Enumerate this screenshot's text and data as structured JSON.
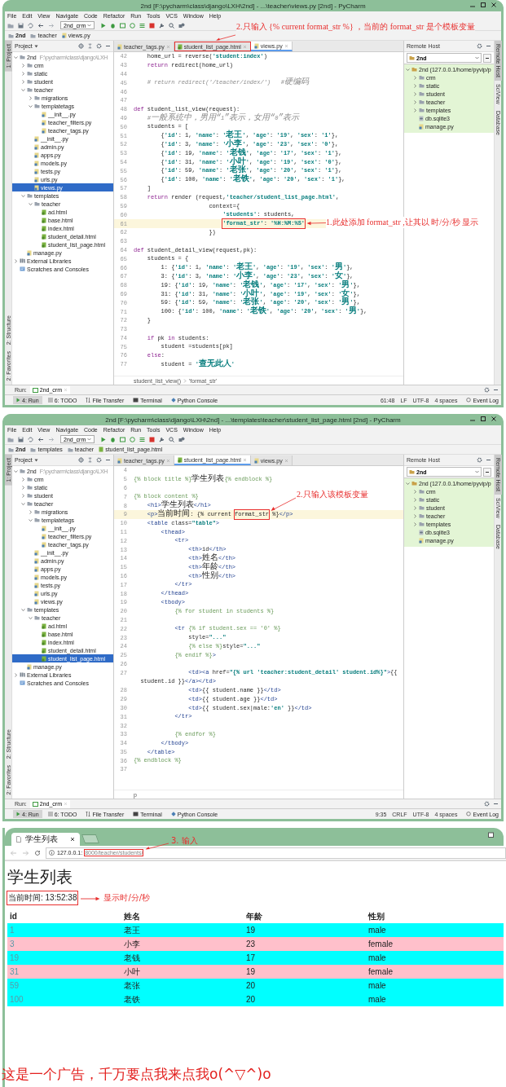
{
  "windows": [
    {
      "title": "2nd [F:\\pycharm\\class\\django\\LXH\\2nd] - ...\\teacher\\views.py [2nd] - PyCharm",
      "menu": [
        "File",
        "Edit",
        "View",
        "Navigate",
        "Code",
        "Refactor",
        "Run",
        "Tools",
        "VCS",
        "Window",
        "Help"
      ],
      "run_config": "2nd_crm",
      "breadcrumb": [
        {
          "label": "2nd",
          "kind": "folder"
        },
        {
          "label": "teacher",
          "kind": "folder"
        },
        {
          "label": "views.py",
          "kind": "python"
        }
      ],
      "tab_note": "2.只输入 {% current format_str %} ，当前的 format_str 是个模板变量",
      "project_header": "Project",
      "tree": [
        {
          "label": "2nd",
          "path": "F:\\pycharm\\class\\django\\LXH",
          "kind": "folder",
          "selected": false,
          "children": [
            {
              "label": "crm",
              "kind": "folder",
              "selected": false
            },
            {
              "label": "static",
              "kind": "folder",
              "selected": false
            },
            {
              "label": "student",
              "kind": "folder",
              "selected": false
            },
            {
              "label": "teacher",
              "kind": "folder",
              "selected": false,
              "children": [
                {
                  "label": "migrations",
                  "kind": "folder",
                  "selected": false
                },
                {
                  "label": "templatetags",
                  "kind": "folder",
                  "selected": false,
                  "children": [
                    {
                      "label": "__init__.py",
                      "kind": "python",
                      "selected": false
                    },
                    {
                      "label": "teacher_filters.py",
                      "kind": "python",
                      "selected": false
                    },
                    {
                      "label": "teacher_tags.py",
                      "kind": "python",
                      "selected": false
                    }
                  ]
                },
                {
                  "label": "__init__.py",
                  "kind": "python",
                  "selected": false
                },
                {
                  "label": "admin.py",
                  "kind": "python",
                  "selected": false
                },
                {
                  "label": "apps.py",
                  "kind": "python",
                  "selected": false
                },
                {
                  "label": "models.py",
                  "kind": "python",
                  "selected": false
                },
                {
                  "label": "tests.py",
                  "kind": "python",
                  "selected": false
                },
                {
                  "label": "urls.py",
                  "kind": "python",
                  "selected": false
                },
                {
                  "label": "views.py",
                  "kind": "python",
                  "selected": true
                }
              ]
            },
            {
              "label": "templates",
              "kind": "folder",
              "selected": false,
              "children": [
                {
                  "label": "teacher",
                  "kind": "folder",
                  "selected": false,
                  "children": [
                    {
                      "label": "ad.html",
                      "kind": "html",
                      "selected": false
                    },
                    {
                      "label": "base.html",
                      "kind": "html",
                      "selected": false
                    },
                    {
                      "label": "index.html",
                      "kind": "html",
                      "selected": false
                    },
                    {
                      "label": "student_detail.html",
                      "kind": "html",
                      "selected": false
                    },
                    {
                      "label": "student_list_page.html",
                      "kind": "html",
                      "selected": false
                    }
                  ]
                }
              ]
            },
            {
              "label": "manage.py",
              "kind": "python",
              "selected": false
            }
          ]
        },
        {
          "label": "External Libraries",
          "kind": "library",
          "selected": false
        },
        {
          "label": "Scratches and Consoles",
          "kind": "scratches",
          "selected": false
        }
      ],
      "tabs": [
        {
          "label": "teacher_tags.py",
          "kind": "python",
          "selected": false,
          "marked": false
        },
        {
          "label": "student_list_page.html",
          "kind": "html",
          "selected": false,
          "marked": true
        },
        {
          "label": "views.py",
          "kind": "python",
          "selected": true,
          "marked": false
        }
      ],
      "code": [
        {
          "num": "42",
          "text": "    home_url = reverse('student:index')",
          "current": false
        },
        {
          "num": "43",
          "text": "    return redirect(home_url)",
          "current": false
        },
        {
          "num": "44",
          "current": false
        },
        {
          "num": "45",
          "text": "    # return redirect('/teacher/index/')   #硬编码",
          "current": false
        },
        {
          "num": "46",
          "current": false
        },
        {
          "num": "47",
          "current": false
        },
        {
          "num": "48",
          "text": "def student_list_view(request):",
          "current": false
        },
        {
          "num": "49",
          "text": "    #一般系统中，男用“1”表示，女用“0”表示",
          "current": false
        },
        {
          "num": "50",
          "text": "    students = [",
          "current": false
        },
        {
          "num": "51",
          "text": "        {'id': 1, 'name': '老王', 'age': '19', 'sex': '1'},",
          "current": false
        },
        {
          "num": "52",
          "text": "        {'id': 3, 'name': '小李', 'age': '23', 'sex': '0'},",
          "current": false
        },
        {
          "num": "53",
          "text": "        {'id': 19, 'name': '老钱', 'age': '17', 'sex': '1'},",
          "current": false
        },
        {
          "num": "54",
          "text": "        {'id': 31, 'name': '小叶', 'age': '19', 'sex': '0'},",
          "current": false
        },
        {
          "num": "55",
          "text": "        {'id': 59, 'name': '老张', 'age': '20', 'sex': '1'},",
          "current": false
        },
        {
          "num": "56",
          "text": "        {'id': 100, 'name': '老铁', 'age': '20', 'sex': '1'},",
          "current": false
        },
        {
          "num": "57",
          "text": "    ]",
          "current": false
        },
        {
          "num": "58",
          "text": "    return render (request,'teacher/student_list_page.html',",
          "current": false
        },
        {
          "num": "59",
          "text": "                      context={",
          "current": false
        },
        {
          "num": "60",
          "text": "                          'students': students,",
          "current": false
        },
        {
          "num": "61",
          "marked": "'format_str': '%H:%M:%S'",
          "note": {
            "text": "1.此处添加 format_str ,让其以 时/分/秒 显示",
            "kind": "side"
          },
          "current": true
        },
        {
          "num": "62",
          "text": "                      })",
          "current": false
        },
        {
          "num": "63",
          "current": false
        },
        {
          "num": "64",
          "text": "def student_detail_view(request,pk):",
          "current": false
        },
        {
          "num": "65",
          "text": "    students = {",
          "current": false
        },
        {
          "num": "66",
          "text": "        1: {'id': 1, 'name': '老王', 'age': '19', 'sex': '男'},",
          "current": false
        },
        {
          "num": "67",
          "text": "        3: {'id': 3, 'name': '小李', 'age': '23', 'sex': '女'},",
          "current": false
        },
        {
          "num": "68",
          "text": "        19: {'id': 19, 'name': '老钱', 'age': '17', 'sex': '男'},",
          "current": false
        },
        {
          "num": "69",
          "text": "        31: {'id': 31, 'name': '小叶', 'age': '19', 'sex': '女'},",
          "current": false
        },
        {
          "num": "70",
          "text": "        59: {'id': 59, 'name': '老张', 'age': '20', 'sex': '男'},",
          "current": false
        },
        {
          "num": "71",
          "text": "        100: {'id': 100, 'name': '老铁', 'age': '20', 'sex': '男'},",
          "current": false
        },
        {
          "num": "72",
          "text": "    }",
          "current": false
        },
        {
          "num": "73",
          "current": false
        },
        {
          "num": "74",
          "text": "    if pk in students:",
          "current": false
        },
        {
          "num": "75",
          "text": "        student =students[pk]",
          "current": false
        },
        {
          "num": "76",
          "text": "    else:",
          "current": false
        },
        {
          "num": "77",
          "text": "        student = '查无此人'",
          "current": false
        }
      ],
      "editor_breadcrumb": [
        "student_list_view()",
        "'format_str'"
      ],
      "remote": {
        "header": "Remote Host",
        "host": "2nd",
        "tree": [
          {
            "label": "2nd (127.0.0.1/home/pyvip/p",
            "kind": "server",
            "selected": false,
            "children": [
              {
                "label": "crm",
                "kind": "folder",
                "selected": false
              },
              {
                "label": "static",
                "kind": "folder",
                "selected": false
              },
              {
                "label": "student",
                "kind": "folder",
                "selected": false
              },
              {
                "label": "teacher",
                "kind": "folder",
                "selected": false
              },
              {
                "label": "templates",
                "kind": "folder",
                "selected": false
              },
              {
                "label": "db.sqlite3",
                "kind": "db",
                "selected": false
              },
              {
                "label": "manage.py",
                "kind": "python",
                "selected": false
              }
            ]
          }
        ]
      },
      "left_strip": [
        {
          "label": "1: Project",
          "selected": true
        },
        {
          "label": "2: Structure",
          "selected": false
        },
        {
          "label": "2: Favorites",
          "selected": false
        }
      ],
      "right_strip": [
        {
          "label": "Remote Host",
          "selected": true
        },
        {
          "label": "SciView",
          "selected": false
        },
        {
          "label": "Database",
          "selected": false
        }
      ],
      "run_label": "Run:",
      "run_tab": "2nd_crm",
      "tool_tabs": [
        {
          "label": "4: Run",
          "kind": "run",
          "selected": true
        },
        {
          "label": "6: TODO",
          "kind": "todo",
          "selected": false
        },
        {
          "label": "File Transfer",
          "kind": "transfer",
          "selected": false
        },
        {
          "label": "Terminal",
          "kind": "terminal",
          "selected": false
        },
        {
          "label": "Python Console",
          "kind": "console",
          "selected": false
        }
      ],
      "status": [
        "61:48",
        "LF",
        "UTF-8",
        "4 spaces"
      ],
      "event_log": "Event Log"
    },
    {
      "title": "2nd [F:\\pycharm\\class\\django\\LXH\\2nd] - ...\\templates\\teacher\\student_list_page.html [2nd] - PyCharm",
      "menu": [
        "File",
        "Edit",
        "View",
        "Navigate",
        "Code",
        "Refactor",
        "Run",
        "Tools",
        "VCS",
        "Window",
        "Help"
      ],
      "run_config": "2nd_crm",
      "breadcrumb": [
        {
          "label": "2nd",
          "kind": "folder"
        },
        {
          "label": "templates",
          "kind": "folder"
        },
        {
          "label": "teacher",
          "kind": "folder"
        },
        {
          "label": "student_list_page.html",
          "kind": "html"
        }
      ],
      "project_header": "Project",
      "tree": [
        {
          "label": "2nd",
          "path": "F:\\pycharm\\class\\django\\LXH",
          "kind": "folder",
          "selected": false,
          "children": [
            {
              "label": "crm",
              "kind": "folder",
              "selected": false
            },
            {
              "label": "static",
              "kind": "folder",
              "selected": false
            },
            {
              "label": "student",
              "kind": "folder",
              "selected": false
            },
            {
              "label": "teacher",
              "kind": "folder",
              "selected": false,
              "children": [
                {
                  "label": "migrations",
                  "kind": "folder",
                  "selected": false
                },
                {
                  "label": "templatetags",
                  "kind": "folder",
                  "selected": false,
                  "children": [
                    {
                      "label": "__init__.py",
                      "kind": "python",
                      "selected": false
                    },
                    {
                      "label": "teacher_filters.py",
                      "kind": "python",
                      "selected": false
                    },
                    {
                      "label": "teacher_tags.py",
                      "kind": "python",
                      "selected": false
                    }
                  ]
                },
                {
                  "label": "__init__.py",
                  "kind": "python",
                  "selected": false
                },
                {
                  "label": "admin.py",
                  "kind": "python",
                  "selected": false
                },
                {
                  "label": "apps.py",
                  "kind": "python",
                  "selected": false
                },
                {
                  "label": "models.py",
                  "kind": "python",
                  "selected": false
                },
                {
                  "label": "tests.py",
                  "kind": "python",
                  "selected": false
                },
                {
                  "label": "urls.py",
                  "kind": "python",
                  "selected": false
                },
                {
                  "label": "views.py",
                  "kind": "python",
                  "selected": false
                }
              ]
            },
            {
              "label": "templates",
              "kind": "folder",
              "selected": false,
              "children": [
                {
                  "label": "teacher",
                  "kind": "folder",
                  "selected": false,
                  "children": [
                    {
                      "label": "ad.html",
                      "kind": "html",
                      "selected": false
                    },
                    {
                      "label": "base.html",
                      "kind": "html",
                      "selected": false
                    },
                    {
                      "label": "index.html",
                      "kind": "html",
                      "selected": false
                    },
                    {
                      "label": "student_detail.html",
                      "kind": "html",
                      "selected": false
                    },
                    {
                      "label": "student_list_page.html",
                      "kind": "html",
                      "selected": true
                    }
                  ]
                }
              ]
            },
            {
              "label": "manage.py",
              "kind": "python",
              "selected": false
            }
          ]
        },
        {
          "label": "External Libraries",
          "kind": "library",
          "selected": false
        },
        {
          "label": "Scratches and Consoles",
          "kind": "scratches",
          "selected": false
        }
      ],
      "tabs": [
        {
          "label": "teacher_tags.py",
          "kind": "python",
          "selected": false,
          "marked": false
        },
        {
          "label": "student_list_page.html",
          "kind": "html",
          "selected": true,
          "marked": false
        },
        {
          "label": "views.py",
          "kind": "python",
          "selected": false,
          "marked": false
        }
      ],
      "code": [
        {
          "num": "4",
          "current": false
        },
        {
          "num": "5",
          "text": "{% block title %}学生列表{% endblock %}",
          "current": false
        },
        {
          "num": "6",
          "current": false
        },
        {
          "num": "7",
          "text": "{% block content %}",
          "current": false
        },
        {
          "num": "8",
          "text": "    <h1>学生列表</h1>",
          "current": false
        },
        {
          "num": "9",
          "text": "    <p>当前时间: {% current ",
          "marked": "format_str",
          "after": " %}</p>",
          "note": {
            "text": "2.只输入该模板变量",
            "kind": "above"
          },
          "current": true
        },
        {
          "num": "10",
          "text": "    <table class=\"table\">",
          "current": false
        },
        {
          "num": "11",
          "text": "        <thead>",
          "current": false
        },
        {
          "num": "12",
          "text": "            <tr>",
          "current": false
        },
        {
          "num": "13",
          "text": "                <th>id</th>",
          "current": false
        },
        {
          "num": "14",
          "text": "                <th>姓名</th>",
          "current": false
        },
        {
          "num": "15",
          "text": "                <th>年龄</th>",
          "current": false
        },
        {
          "num": "16",
          "text": "                <th>性别</th>",
          "current": false
        },
        {
          "num": "17",
          "text": "            </tr>",
          "current": false
        },
        {
          "num": "18",
          "text": "        </thead>",
          "current": false
        },
        {
          "num": "19",
          "text": "        <tbody>",
          "current": false
        },
        {
          "num": "20",
          "text": "            {% for student in students %}",
          "current": false
        },
        {
          "num": "21",
          "current": false
        },
        {
          "num": "22",
          "text": "            <tr {% if student.sex == '0' %}",
          "current": false
        },
        {
          "num": "23",
          "text": "                style=\"...\"",
          "current": false
        },
        {
          "num": "24",
          "text": "                {% else %}style=\"...\"",
          "current": false
        },
        {
          "num": "25",
          "text": "            {% endif %}>",
          "current": false
        },
        {
          "num": "26",
          "current": false
        },
        {
          "num": "27",
          "text": "                <td><a href=\"{% url 'teacher:student_detail' student.id%}\">{{",
          "current": false
        },
        {
          "text": "  student.id }}</a></td>",
          "current": false
        },
        {
          "num": "28",
          "text": "                <td>{{ student.name }}</td>",
          "current": false
        },
        {
          "num": "29",
          "text": "                <td>{{ student.age }}</td>",
          "current": false
        },
        {
          "num": "30",
          "text": "                <td>{{ student.sex|male:'en' }}</td>",
          "current": false
        },
        {
          "num": "31",
          "text": "            </tr>",
          "current": false
        },
        {
          "num": "32",
          "current": false
        },
        {
          "num": "33",
          "text": "            {% endfor %}",
          "current": false
        },
        {
          "num": "34",
          "text": "        </tbody>",
          "current": false
        },
        {
          "num": "35",
          "text": "    </table>",
          "current": false
        },
        {
          "num": "36",
          "text": "{% endblock %}",
          "current": false
        },
        {
          "num": "37",
          "current": false
        }
      ],
      "editor_breadcrumb": [
        "p"
      ],
      "remote": {
        "header": "Remote Host",
        "host": "2nd",
        "tree": [
          {
            "label": "2nd (127.0.0.1/home/pyvip/p",
            "kind": "server",
            "selected": false,
            "children": [
              {
                "label": "crm",
                "kind": "folder",
                "selected": false
              },
              {
                "label": "static",
                "kind": "folder",
                "selected": false
              },
              {
                "label": "student",
                "kind": "folder",
                "selected": false
              },
              {
                "label": "teacher",
                "kind": "folder",
                "selected": false
              },
              {
                "label": "templates",
                "kind": "folder",
                "selected": false
              },
              {
                "label": "db.sqlite3",
                "kind": "db",
                "selected": false
              },
              {
                "label": "manage.py",
                "kind": "python",
                "selected": false
              }
            ]
          }
        ]
      },
      "left_strip": [
        {
          "label": "1: Project",
          "selected": true
        },
        {
          "label": "2: Structure",
          "selected": false
        },
        {
          "label": "2: Favorites",
          "selected": false
        }
      ],
      "right_strip": [
        {
          "label": "Remote Host",
          "selected": true
        },
        {
          "label": "SciView",
          "selected": false
        },
        {
          "label": "Database",
          "selected": false
        }
      ],
      "run_label": "Run:",
      "run_tab": "2nd_crm",
      "tool_tabs": [
        {
          "label": "4: Run",
          "kind": "run",
          "selected": true
        },
        {
          "label": "6: TODO",
          "kind": "todo",
          "selected": false
        },
        {
          "label": "File Transfer",
          "kind": "transfer",
          "selected": false
        },
        {
          "label": "Terminal",
          "kind": "terminal",
          "selected": false
        },
        {
          "label": "Python Console",
          "kind": "console",
          "selected": false
        }
      ],
      "status": [
        "9:35",
        "CRLF",
        "UTF-8",
        "4 spaces"
      ],
      "event_log": "Event Log"
    }
  ],
  "browser": {
    "tab": "学生列表",
    "url_host": "127.0.0.1:",
    "url_marked": "8000/teacher/students/",
    "url_note": "3. 输入",
    "heading": "学生列表",
    "time": "当前时间: 13:52:38",
    "time_note": "显示时/分/秒",
    "columns": [
      "id",
      "姓名",
      "年龄",
      "性别"
    ],
    "rows": [
      {
        "cells": [
          "1",
          "老王",
          "19",
          "male"
        ],
        "color": "#00ffff"
      },
      {
        "cells": [
          "3",
          "小李",
          "23",
          "female"
        ],
        "color": "#ffc0cb"
      },
      {
        "cells": [
          "19",
          "老钱",
          "17",
          "male"
        ],
        "color": "#00ffff"
      },
      {
        "cells": [
          "31",
          "小叶",
          "19",
          "female"
        ],
        "color": "#ffc0cb"
      },
      {
        "cells": [
          "59",
          "老张",
          "20",
          "male"
        ],
        "color": "#00ffff"
      },
      {
        "cells": [
          "100",
          "老铁",
          "20",
          "male"
        ],
        "color": "#00ffff"
      }
    ]
  },
  "ad": "这是一个广告，千万要点我来点我o(^▽^)o"
}
